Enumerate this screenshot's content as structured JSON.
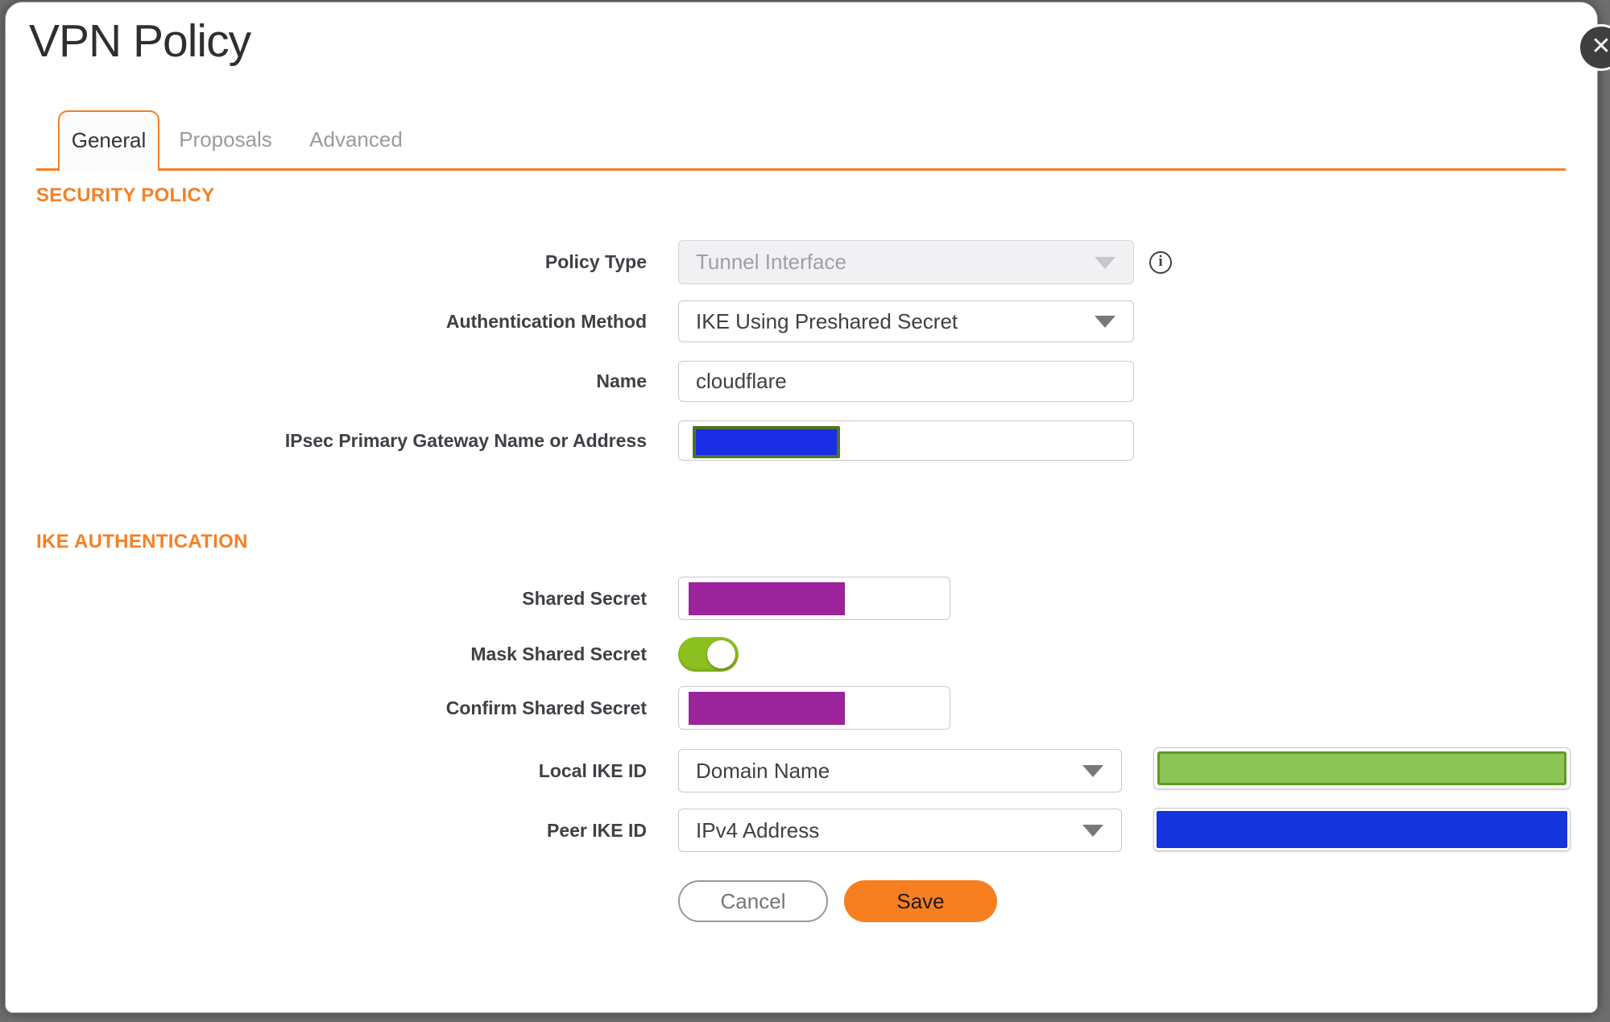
{
  "dialog": {
    "title": "VPN Policy",
    "close_glyph": "✕"
  },
  "tabs": [
    {
      "label": "General",
      "active": true
    },
    {
      "label": "Proposals",
      "active": false
    },
    {
      "label": "Advanced",
      "active": false
    }
  ],
  "sections": {
    "security_policy": "SECURITY POLICY",
    "ike_authentication": "IKE AUTHENTICATION"
  },
  "fields": {
    "policy_type": {
      "label": "Policy Type",
      "value": "Tunnel Interface",
      "disabled": true,
      "info_glyph": "i"
    },
    "auth_method": {
      "label": "Authentication Method",
      "value": "IKE Using Preshared Secret"
    },
    "name": {
      "label": "Name",
      "value": "cloudflare"
    },
    "gateway": {
      "label": "IPsec Primary Gateway Name or Address",
      "value": "",
      "redacted": true
    },
    "shared_secret": {
      "label": "Shared Secret",
      "value": "",
      "redacted": true
    },
    "mask_shared_secret": {
      "label": "Mask Shared Secret",
      "enabled": true
    },
    "confirm_shared_secret": {
      "label": "Confirm Shared Secret",
      "value": "",
      "redacted": true
    },
    "local_ike_id": {
      "label": "Local IKE ID",
      "value": "Domain Name",
      "id_value": "",
      "id_redacted": true
    },
    "peer_ike_id": {
      "label": "Peer IKE ID",
      "value": "IPv4 Address",
      "id_value": "",
      "id_redacted": true
    }
  },
  "buttons": {
    "cancel": "Cancel",
    "save": "Save"
  },
  "colors": {
    "accent_orange": "#f58025",
    "save_orange": "#f77f20",
    "toggle_green": "#8cc021",
    "redaction_purple": "#9b249b",
    "redaction_blue": "#1b2be6",
    "redaction_green_fill": "#8cc456",
    "redaction_green_border": "#5d9a26",
    "redaction_olive_border": "#4e7522",
    "backdrop_grey": "#6e6e6e"
  }
}
